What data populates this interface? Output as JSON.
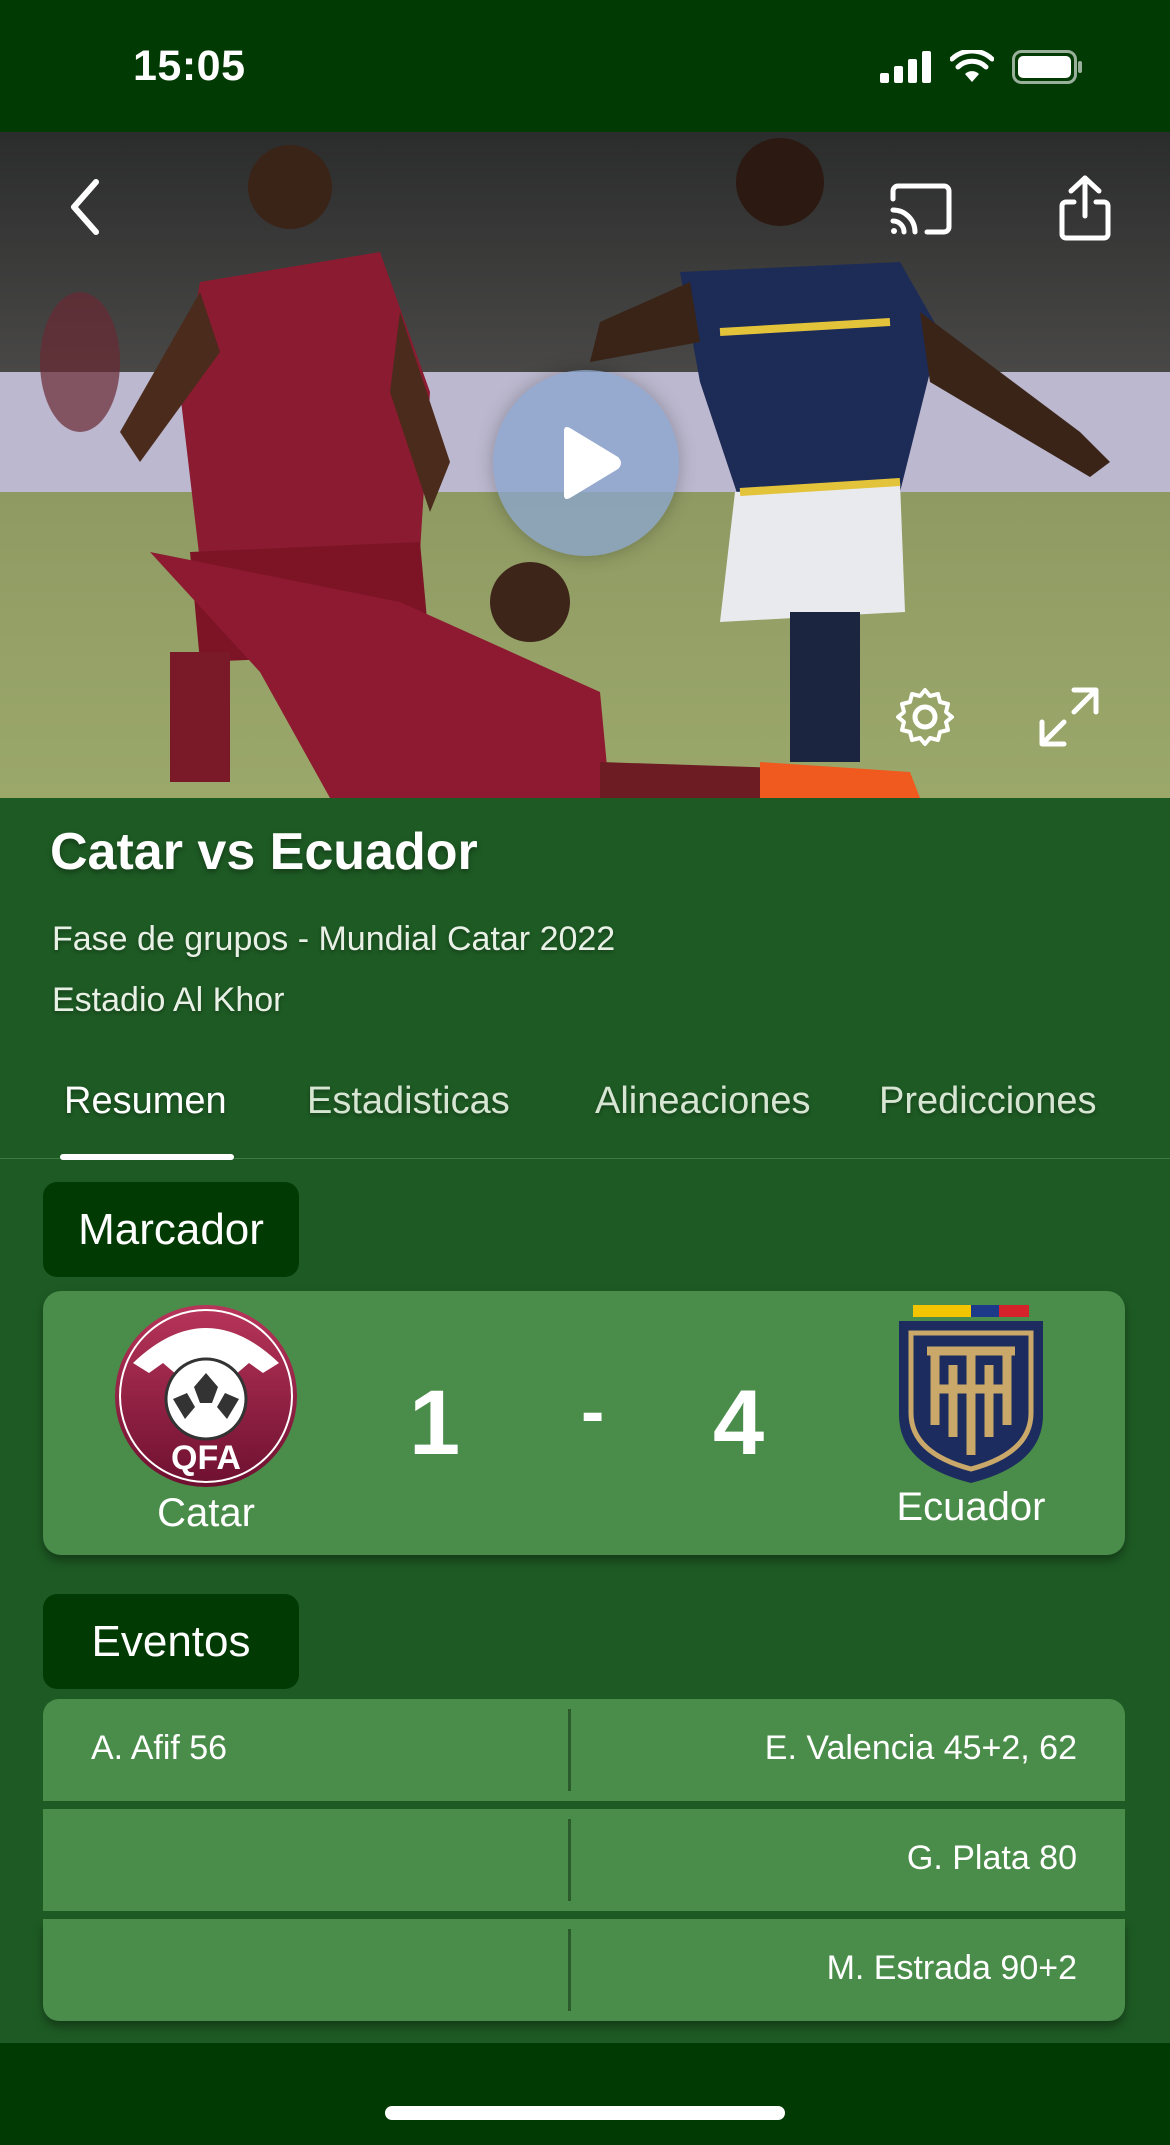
{
  "status_bar": {
    "time": "15:05"
  },
  "video": {
    "back_icon": "chevron-left-icon",
    "cast_icon": "cast-icon",
    "share_icon": "share-icon",
    "play_icon": "play-icon",
    "settings_icon": "gear-icon",
    "fullscreen_icon": "expand-icon"
  },
  "match": {
    "title": "Catar vs Ecuador",
    "stage": "Fase de grupos - Mundial Catar 2022",
    "stadium": "Estadio Al Khor"
  },
  "tabs": [
    {
      "label": "Resumen",
      "active": true
    },
    {
      "label": "Estadisticas",
      "active": false
    },
    {
      "label": "Alineaciones",
      "active": false
    },
    {
      "label": "Predicciones",
      "active": false
    }
  ],
  "scoreboard": {
    "section_label": "Marcador",
    "home": {
      "name": "Catar",
      "score": "1",
      "crest_text": "QFA"
    },
    "separator": "-",
    "away": {
      "name": "Ecuador",
      "score": "4"
    }
  },
  "events": {
    "section_label": "Eventos",
    "rows": [
      {
        "home": "A. Afif 56",
        "away": "E. Valencia 45+2, 62"
      },
      {
        "home": "",
        "away": "G. Plata 80"
      },
      {
        "home": "",
        "away": "M. Estrada 90+2"
      }
    ]
  },
  "colors": {
    "background": "#1e5b24",
    "dark_green": "#023a04",
    "card_green": "#4a8c4a",
    "qatar_maroon": "#8a1538",
    "ecuador_navy": "#1d2c5e",
    "ecuador_gold": "#c9a86a"
  }
}
